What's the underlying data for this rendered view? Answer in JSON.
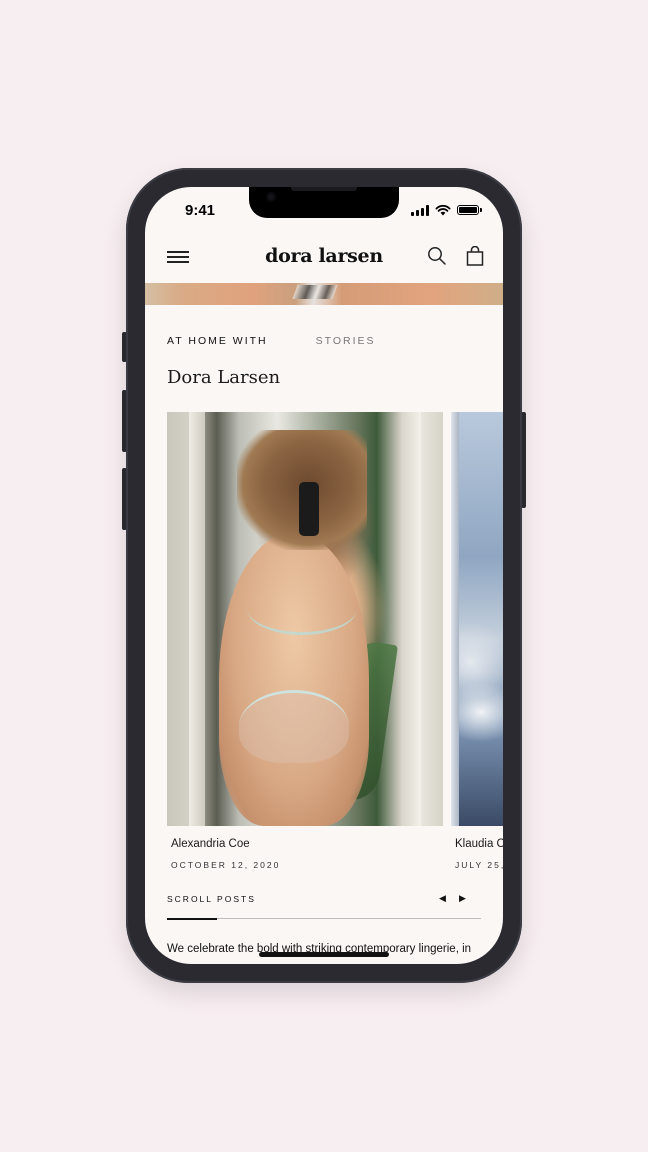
{
  "status_bar": {
    "time": "9:41"
  },
  "header": {
    "brand": "dora larsen"
  },
  "tabs": [
    {
      "label": "AT HOME WITH",
      "active": true
    },
    {
      "label": "STORIES",
      "active": false
    }
  ],
  "page_title": "Dora Larsen",
  "posts": [
    {
      "name": "Alexandria Coe",
      "date": "OCTOBER 12, 2020"
    },
    {
      "name": "Klaudia C",
      "date": "JULY 25,"
    }
  ],
  "scroll": {
    "label": "SCROLL POSTS",
    "prev": "◀",
    "next": "▶",
    "progress": 0.16
  },
  "body_text": "We celebrate the bold with striking contemporary lingerie, in",
  "colors": {
    "background": "#f7eef1",
    "screen": "#faf7f5",
    "text": "#111111"
  },
  "icons": [
    "menu-icon",
    "search-icon",
    "shopping-bag-icon",
    "wifi-icon",
    "battery-icon",
    "signal-icon"
  ]
}
